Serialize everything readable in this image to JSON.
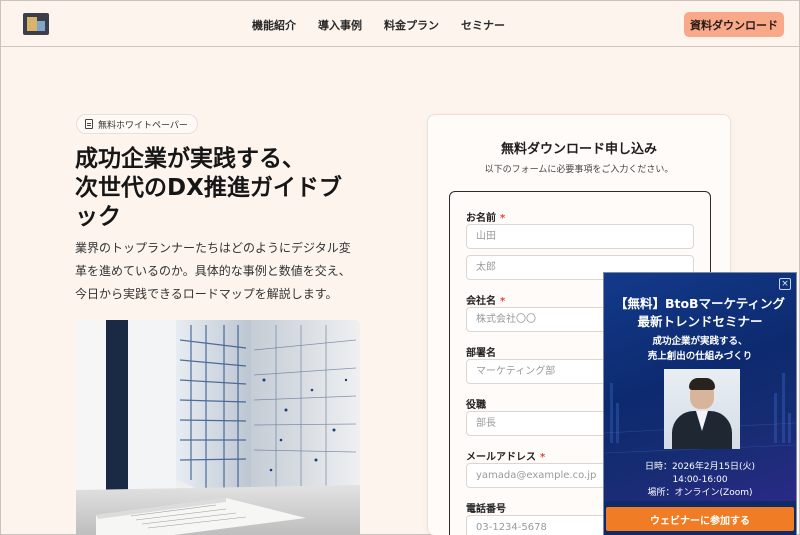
{
  "header": {
    "nav": [
      "機能紹介",
      "導入事例",
      "料金プラン",
      "セミナー"
    ],
    "cta_label": "資料ダウンロード"
  },
  "hero": {
    "badge": "無料ホワイトペーパー",
    "title_lines": [
      "成功企業が実践する、",
      "次世代のDX推進ガイドブ",
      "ック"
    ],
    "desc_lines": [
      "業界のトップランナーたちはどのようにデジタル変",
      "革を進めているのか。具体的な事例と数値を交え、",
      "今日から実践できるロードマップを解説します。"
    ]
  },
  "form": {
    "title": "無料ダウンロード申し込み",
    "subtitle": "以下のフォームに必要事項をご入力ください。",
    "name_label": "お名前",
    "last_name_placeholder": "山田",
    "first_name_placeholder": "太郎",
    "company_label": "会社名",
    "company_placeholder": "株式会社〇〇",
    "department_label": "部署名",
    "department_placeholder": "マーケティング部",
    "position_label": "役職",
    "position_placeholder": "部長",
    "email_label": "メールアドレス",
    "email_placeholder": "yamada@example.co.jp",
    "phone_label": "電話番号",
    "phone_placeholder": "03-1234-5678",
    "required_mark": "*"
  },
  "popup": {
    "close": "×",
    "title_lines": [
      "【無料】BtoBマーケティング",
      "最新トレンドセミナー"
    ],
    "subtitle_lines": [
      "成功企業が実践する、",
      "売上創出の仕組みづくり"
    ],
    "info_lines": [
      "日時：2026年2月15日(火)",
      "14:00-16:00",
      "場所：オンライン(Zoom)"
    ],
    "button": "ウェビナーに参加する"
  },
  "colors": {
    "background": "#fdf4ee",
    "cta": "#f7a98a",
    "popup_bg": "#0f2a66",
    "popup_button": "#f07d25",
    "required": "#e0473d"
  }
}
